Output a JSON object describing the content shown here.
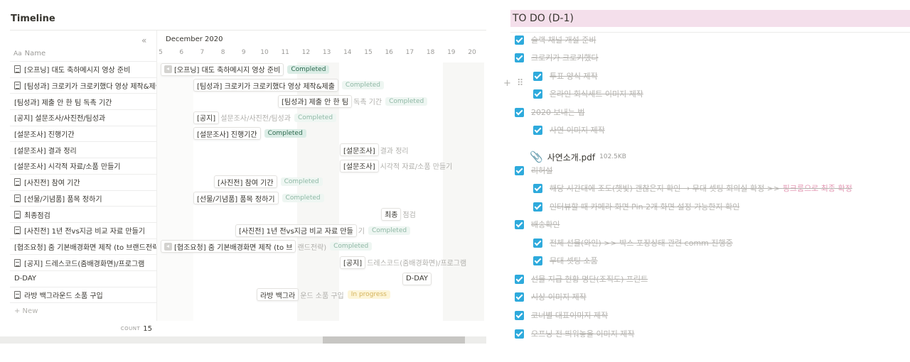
{
  "timeline": {
    "title": "Timeline",
    "collapse_icon": "«",
    "name_col_icon": "Aa",
    "name_col_label": "Name",
    "month": "December 2020",
    "days": [
      "5",
      "6",
      "7",
      "8",
      "9",
      "10",
      "11",
      "12",
      "13",
      "14",
      "15",
      "16",
      "17",
      "18",
      "19",
      "20"
    ],
    "rows": [
      {
        "name": "[오프닝] 대도 축하메시지 영상 준비",
        "doc": true
      },
      {
        "name": "[팀성과] 크로키가 크로키했다 영상 제작&제출",
        "doc": true
      },
      {
        "name": "[팀성과] 제출 안 한 팀 독촉 기간",
        "doc": false
      },
      {
        "name": "[공지] 설문조사/사진전/팀성과",
        "doc": false
      },
      {
        "name": "[설문조사] 진행기간",
        "doc": false
      },
      {
        "name": "[설문조사] 결과 정리",
        "doc": false
      },
      {
        "name": "[설문조사] 시각적 자료/소품 만들기",
        "doc": false
      },
      {
        "name": "[사진전] 참여 기간",
        "doc": true
      },
      {
        "name": "[선물/기념품] 품목 정하기",
        "doc": true
      },
      {
        "name": "최종점검",
        "doc": true
      },
      {
        "name": "[사진전] 1년 전vs지금 비교 자료 만들기",
        "doc": true
      },
      {
        "name": "[협조요청] 줌 기본배경화면 제작 (to 브랜드전략)",
        "doc": false
      },
      {
        "name": "[공지] 드레스코드(줌배경화면)/프로그램",
        "doc": true
      },
      {
        "name": "D-DAY",
        "doc": false
      },
      {
        "name": "라방 백그라운드 소품 구입",
        "doc": true
      }
    ],
    "bars": [
      {
        "label": "[오프닝] 대도 축하메시지 영상 준비",
        "rest": "",
        "status": "Completed",
        "status_style": "done",
        "arrow": true
      },
      {
        "label": "[팀성과] 크로키가 크로키했다 영상 제작&제출",
        "rest": "",
        "status": "Completed",
        "status_style": "done faint",
        "arrow": false
      },
      {
        "label": "[팀성과] 제출 안 한 팀",
        "rest": "독촉 기간",
        "status": "Completed",
        "status_style": "done faint",
        "arrow": false
      },
      {
        "label": "[공지]",
        "rest": "설문조사/사진전/팀성과",
        "status": "Completed",
        "status_style": "done faint",
        "arrow": false
      },
      {
        "label": "[설문조사] 진행기간",
        "rest": "",
        "status": "Completed",
        "status_style": "done",
        "arrow": false
      },
      {
        "label": "[설문조사]",
        "rest": "결과 정리",
        "status": "",
        "status_style": "",
        "arrow": false
      },
      {
        "label": "[설문조사]",
        "rest": "시각적 자료/소품 만들기",
        "status": "",
        "status_style": "",
        "arrow": false
      },
      {
        "label": "[사진전] 참여 기간",
        "rest": "",
        "status": "Completed",
        "status_style": "done faint",
        "arrow": false
      },
      {
        "label": "[선물/기념품] 품목 정하기",
        "rest": "",
        "status": "Completed",
        "status_style": "done faint",
        "arrow": false
      },
      {
        "label": "최종",
        "rest": "점검",
        "status": "",
        "status_style": "",
        "arrow": false
      },
      {
        "label": "[사진전] 1년 전vs지금 비교 자료 만들",
        "rest": "기",
        "status": "Completed",
        "status_style": "done faint",
        "arrow": false
      },
      {
        "label": "[협조요청] 줌 기본배경화면 제작 (to 브",
        "rest": "랜드전략)",
        "status": "Completed",
        "status_style": "done faint",
        "arrow": true
      },
      {
        "label": "[공지]",
        "rest": "드레스코드(줌배경화면)/프로그램",
        "status": "",
        "status_style": "",
        "arrow": false
      },
      {
        "label": "D-DAY",
        "rest": "",
        "status": "",
        "status_style": "",
        "arrow": false
      },
      {
        "label": "라방 백그라",
        "rest": "운드 소품 구입",
        "status": "In progress",
        "status_style": "prog",
        "arrow": false
      }
    ],
    "new_label": "+ New",
    "count_label": "COUNT",
    "count_value": "15"
  },
  "todo": {
    "title": "TO DO (D-1)",
    "title_bg": "#f4dfeb",
    "checkbox_color": "#2eaadc",
    "items": [
      {
        "text": "슬랙 채널 개설 준비",
        "indent": 0
      },
      {
        "text": "크로키가 크로키했다",
        "indent": 0
      },
      {
        "text": "투표 양식 제작",
        "indent": 1
      },
      {
        "text": "온라인 회식세트 이미지 제작",
        "indent": 1
      },
      {
        "text": "2020 보내는 법",
        "indent": 0
      },
      {
        "text": "사연 이미지 제작",
        "indent": 1
      },
      {
        "text": "리허설",
        "indent": 0
      },
      {
        "text": "해당 시간대에 조도(햇빛) 괜찮은지 확인 → 무대 셋팅 회의실 확정 >> ",
        "pink": "핑크룸으로 최종 확정",
        "indent": 1
      },
      {
        "text": "인터뷰할 때 카메라 화면 Pin 2개 화면 설정 가능한지 확인",
        "indent": 1
      },
      {
        "text": "배송확인",
        "indent": 0
      },
      {
        "text": "전체 선물(와인) >> 박스 포장상태 관련 comm 진행중",
        "indent": 1
      },
      {
        "text": "무대 셋팅 소품",
        "indent": 1
      },
      {
        "text": "선물 지급 현황 명단(조직도) 프린트",
        "indent": 0
      },
      {
        "text": "시상 이미지 제작",
        "indent": 0
      },
      {
        "text": "코너별 대표이미지 제작",
        "indent": 0
      },
      {
        "text": "오프닝 전 띄워놓을 이미지 제작",
        "indent": 0
      }
    ],
    "file": {
      "name": "사연소개.pdf",
      "size": "102.5KB"
    }
  }
}
